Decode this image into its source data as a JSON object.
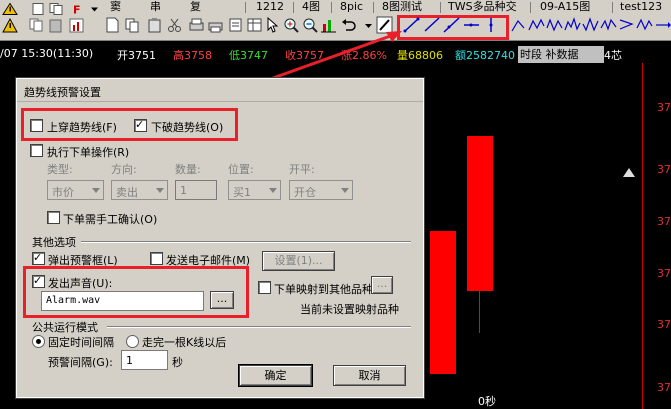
{
  "toolbar": {
    "tabs": [
      "1212",
      "4图",
      "8pic",
      "8图测试",
      "TWS多品种交",
      "09-A15图",
      "test123"
    ],
    "menus": [
      "窦",
      "串",
      "复"
    ]
  },
  "infobar": {
    "time": "/07 15:30(11:30)",
    "open": "开3751",
    "high": "高3758",
    "low": "低3747",
    "close": "收3757",
    "change": "涨2.86%",
    "volume": "量68806",
    "amount": "额2582740",
    "tail": "4芯"
  },
  "tooltip": "时段 补数据",
  "chart": {
    "price_labels": [
      "37",
      "37",
      "37",
      "37",
      "37",
      "37"
    ],
    "bottom_label": "0秒"
  },
  "dialog": {
    "title": "趋势线预警设置",
    "cross_up": {
      "label": "上穿趋势线(F)",
      "checked": false
    },
    "cross_down": {
      "label": "下破趋势线(O)",
      "checked": true
    },
    "exec_order": {
      "label": "执行下单操作(R)",
      "checked": false
    },
    "order_fields": {
      "type_label": "类型:",
      "type_value": "市价",
      "direction_label": "方向:",
      "direction_value": "卖出",
      "qty_label": "数量:",
      "qty_value": "1",
      "pos_label": "位置:",
      "pos_value": "买1",
      "open_label": "开平:",
      "open_value": "开仓"
    },
    "manual_confirm": {
      "label": "下单需手工确认(O)",
      "checked": false
    },
    "other_label": "其他选项",
    "popup": {
      "label": "弹出预警框(L)",
      "checked": true
    },
    "email": {
      "label": "发送电子邮件(M)",
      "checked": false
    },
    "email_settings_btn": "设置(1)...",
    "sound": {
      "label": "发出声音(U):",
      "checked": true
    },
    "sound_file": "Alarm.wav",
    "browse_btn": "...",
    "map_order": {
      "label": "下单映射到其他品种",
      "checked": false
    },
    "map_btn": "...",
    "map_status": "当前未设置映射品种",
    "public_mode_label": "公共运行模式",
    "fixed_interval": {
      "label": "固定时间间隔",
      "selected": true
    },
    "after_bar": {
      "label": "走完一根K线以后",
      "selected": false
    },
    "interval_label": "预警间隔(G):",
    "interval_value": "1",
    "interval_unit": "秒",
    "ok_btn": "确定",
    "cancel_btn": "取消"
  }
}
